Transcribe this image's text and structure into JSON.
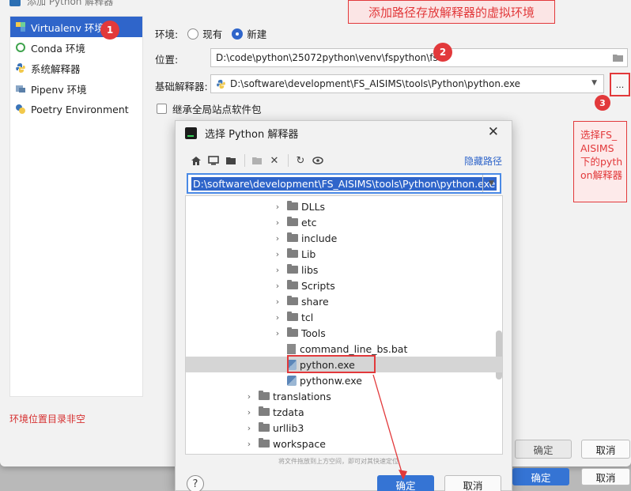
{
  "outer_dialog": {
    "title": "添加 Python 解释器",
    "sidebar": [
      {
        "label": "Virtualenv 环境",
        "icon": "virtualenv-icon",
        "selected": true
      },
      {
        "label": "Conda 环境",
        "icon": "conda-icon",
        "selected": false
      },
      {
        "label": "系统解释器",
        "icon": "python-icon",
        "selected": false
      },
      {
        "label": "Pipenv 环境",
        "icon": "pipenv-icon",
        "selected": false
      },
      {
        "label": "Poetry Environment",
        "icon": "poetry-icon",
        "selected": false
      }
    ],
    "env_label": "环境:",
    "env_existing": "现有",
    "env_new": "新建",
    "location_label": "位置:",
    "location_value": "D:\\code\\python\\25072python\\venv\\fspython\\fs",
    "base_interpreter_label": "基础解释器:",
    "base_interpreter_value": "D:\\software\\development\\FS_AISIMS\\tools\\Python\\python.exe",
    "browse_button": "...",
    "inherit_packages": "继承全局站点软件包",
    "warning": "环境位置目录非空",
    "ok": "确定",
    "cancel": "取消"
  },
  "annotations": {
    "banner": "添加路径存放解释器的虚拟环境",
    "badge1": "1",
    "badge2": "2",
    "badge3": "3",
    "note": "选择FS_AISIMS下的python解释器"
  },
  "file_dialog": {
    "title": "选择 Python 解释器",
    "hide_path": "隐藏路径",
    "path": "D:\\software\\development\\FS_AISIMS\\tools\\Python\\python.exe",
    "tree": [
      {
        "name": "DLLs",
        "type": "folder",
        "depth": 1
      },
      {
        "name": "etc",
        "type": "folder",
        "depth": 1
      },
      {
        "name": "include",
        "type": "folder",
        "depth": 1
      },
      {
        "name": "Lib",
        "type": "folder",
        "depth": 1
      },
      {
        "name": "libs",
        "type": "folder",
        "depth": 1
      },
      {
        "name": "Scripts",
        "type": "folder",
        "depth": 1
      },
      {
        "name": "share",
        "type": "folder",
        "depth": 1
      },
      {
        "name": "tcl",
        "type": "folder",
        "depth": 1
      },
      {
        "name": "Tools",
        "type": "folder",
        "depth": 1
      },
      {
        "name": "command_line_bs.bat",
        "type": "file",
        "depth": 1
      },
      {
        "name": "python.exe",
        "type": "python",
        "depth": 1,
        "selected": true
      },
      {
        "name": "pythonw.exe",
        "type": "python",
        "depth": 1
      },
      {
        "name": "translations",
        "type": "folder",
        "depth": 0
      },
      {
        "name": "tzdata",
        "type": "folder",
        "depth": 0
      },
      {
        "name": "urllib3",
        "type": "folder",
        "depth": 0
      },
      {
        "name": "workspace",
        "type": "folder",
        "depth": 0
      }
    ],
    "drop_hint": "将文件拖放到上方空间，即可对其快速定位",
    "help": "?",
    "ok": "确定",
    "cancel": "取消"
  },
  "colors": {
    "accent": "#2f65ca",
    "annotation_red": "#e2393b"
  }
}
